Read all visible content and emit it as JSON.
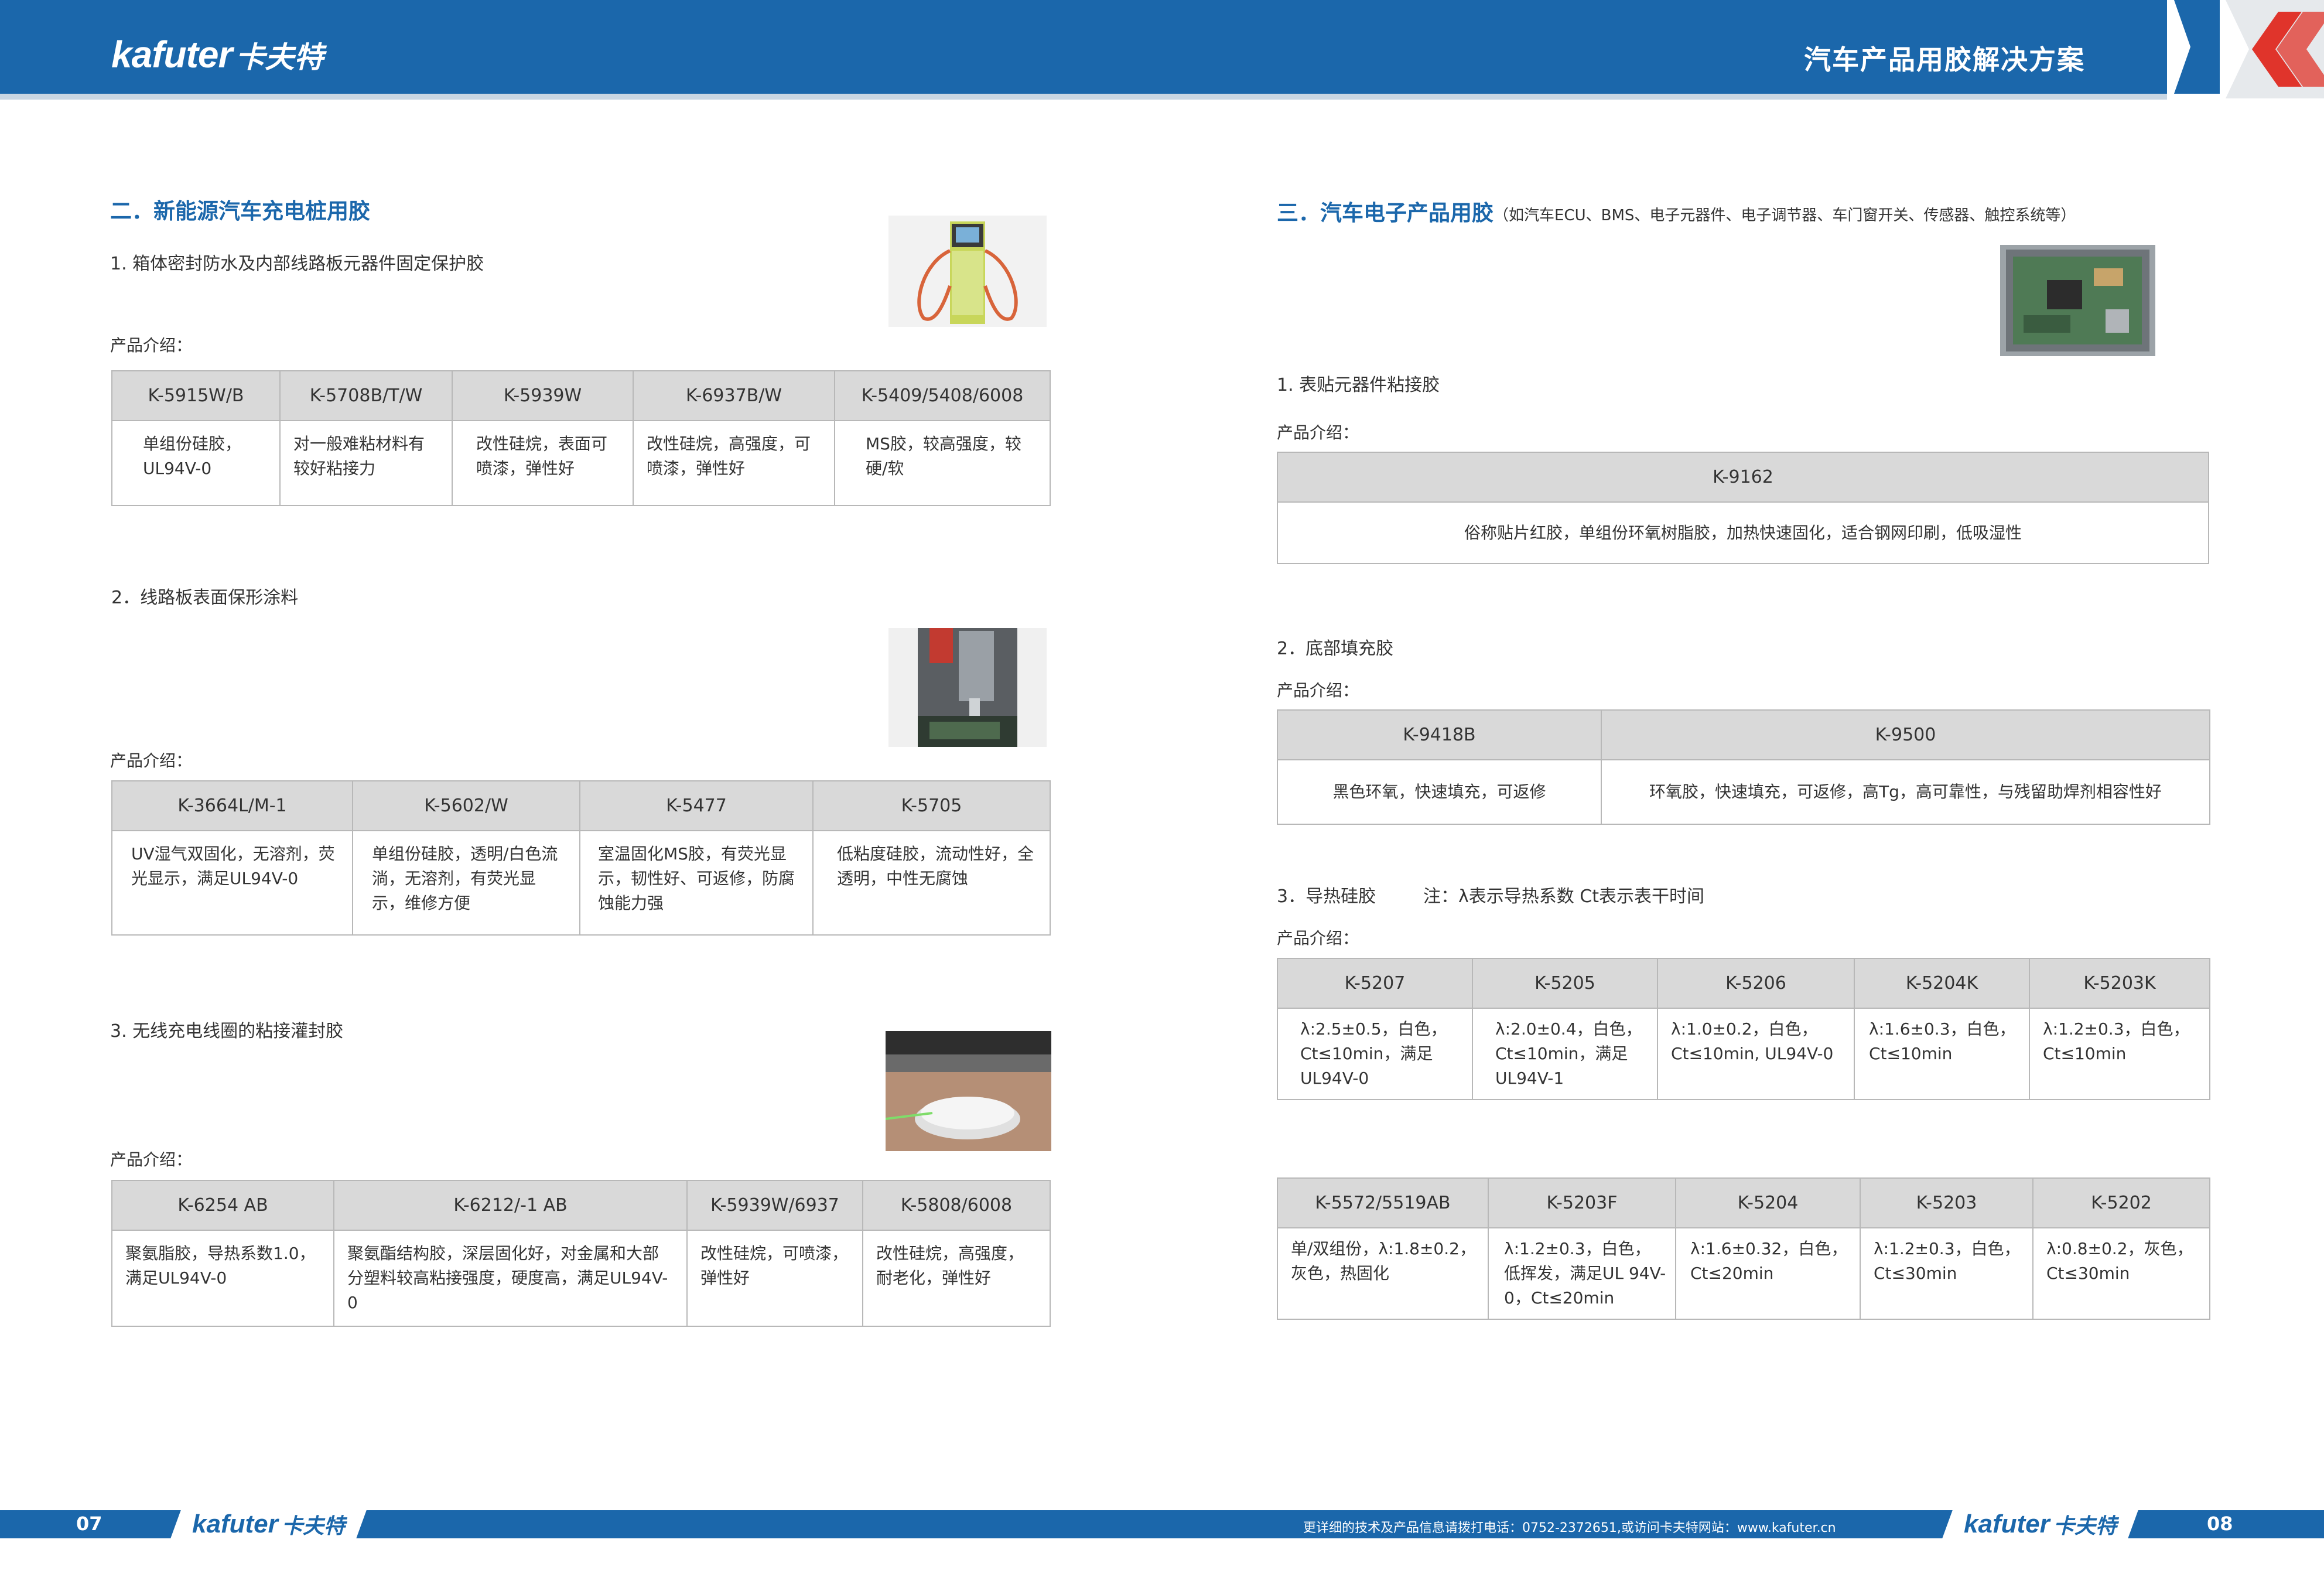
{
  "header": {
    "logo_en": "kafuter",
    "logo_cn": "卡夫特",
    "title": "汽车产品用胶解决方案"
  },
  "left": {
    "section_title": "二．新能源汽车充电桩用胶",
    "sub1": {
      "title": "1. 箱体密封防水及内部线路板元器件固定保护胶",
      "label": "产品介绍：",
      "headers": [
        "K-5915W/B",
        "K-5708B/T/W",
        "K-5939W",
        "K-6937B/W",
        "K-5409/5408/6008"
      ],
      "cells": [
        "单组份硅胶，UL94V-0",
        "对一般难粘材料有较好粘接力",
        "改性硅烷，表面可喷漆，弹性好",
        "改性硅烷，高强度，可喷漆，弹性好",
        "MS胶，较高强度，较硬/软"
      ]
    },
    "sub2": {
      "title": "2．线路板表面保形涂料",
      "label": "产品介绍：",
      "headers": [
        "K-3664L/M-1",
        "K-5602/W",
        "K-5477",
        "K-5705"
      ],
      "cells": [
        "UV湿气双固化，无溶剂，荧光显示，满足UL94V-0",
        "单组份硅胶，透明/白色流淌，无溶剂，有荧光显示，维修方便",
        "室温固化MS胶，有荧光显示，韧性好、可返修，防腐蚀能力强",
        "低粘度硅胶，流动性好，全透明，中性无腐蚀"
      ]
    },
    "sub3": {
      "title": "3. 无线充电线圈的粘接灌封胶",
      "label": "产品介绍：",
      "headers": [
        "K-6254 AB",
        "K-6212/-1 AB",
        "K-5939W/6937",
        "K-5808/6008"
      ],
      "cells": [
        "聚氨脂胶，导热系数1.0，满足UL94V-0",
        "聚氨酯结构胶，深层固化好，对金属和大部分塑料较高粘接强度，硬度高，满足UL94V-0",
        "改性硅烷，可喷漆，弹性好",
        "改性硅烷，高强度，耐老化，弹性好"
      ]
    }
  },
  "right": {
    "section_title": "三．汽车电子产品用胶",
    "section_note": "（如汽车ECU、BMS、电子元器件、电子调节器、车门窗开关、传感器、触控系统等）",
    "sub1": {
      "title": "1. 表贴元器件粘接胶",
      "label": "产品介绍：",
      "headers": [
        "K-9162"
      ],
      "cells": [
        "俗称贴片红胶，单组份环氧树脂胶，加热快速固化，适合钢网印刷，低吸湿性"
      ]
    },
    "sub2": {
      "title": "2．底部填充胶",
      "label": "产品介绍：",
      "headers": [
        "K-9418B",
        "K-9500"
      ],
      "cells": [
        "黑色环氧，快速填充，可返修",
        "环氧胶，快速填充，可返修，高Tg，高可靠性，与残留助焊剂相容性好"
      ]
    },
    "sub3": {
      "title": "3．导热硅胶",
      "note": "注：λ表示导热系数   Ct表示表干时间",
      "label": "产品介绍：",
      "headers": [
        "K-5207",
        "K-5205",
        "K-5206",
        "K-5204K",
        "K-5203K"
      ],
      "cells": [
        "λ:2.5±0.5，白色，Ct≤10min，满足UL94V-0",
        "λ:2.0±0.4，白色，Ct≤10min，满足UL94V-1",
        "λ:1.0±0.2，白色，Ct≤10min, UL94V-0",
        "λ:1.6±0.3，白色，Ct≤10min",
        "λ:1.2±0.3，白色，Ct≤10min"
      ],
      "headers2": [
        "K-5572/5519AB",
        "K-5203F",
        "K-5204",
        "K-5203",
        "K-5202"
      ],
      "cells2": [
        "单/双组份，λ:1.8±0.2，灰色，热固化",
        "λ:1.2±0.3，白色，低挥发，满足UL 94V-0，Ct≤20min",
        "λ:1.6±0.32，白色，Ct≤20min",
        "λ:1.2±0.3，白色，Ct≤30min",
        "λ:0.8±0.2，灰色，Ct≤30min"
      ]
    }
  },
  "footer": {
    "page_left": "07",
    "page_right": "08",
    "note": "更详细的技术及产品信息请拨打电话：0752-2372651,或访问卡夫特网站：www.kafuter.cn",
    "logo_en": "kafuter",
    "logo_cn": "卡夫特"
  },
  "colors": {
    "brand_blue": "#1b67ab",
    "accent_red": "#e0342b",
    "table_header": "#d9d9d9"
  }
}
